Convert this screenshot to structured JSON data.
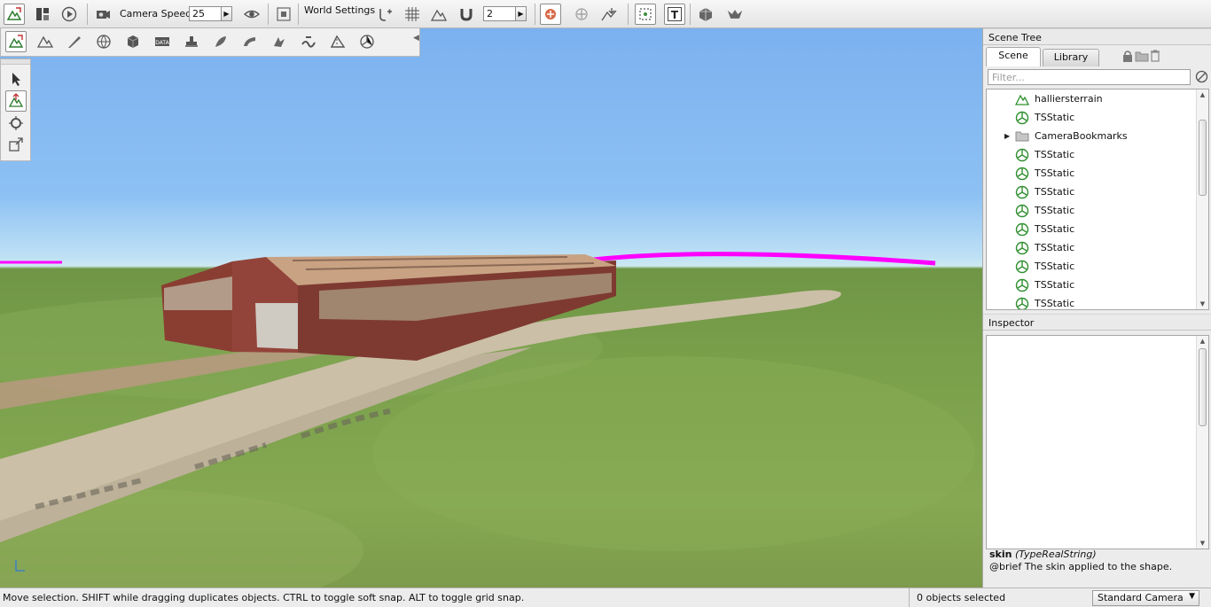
{
  "toolbar": {
    "camera_speed_label": "Camera Speed",
    "camera_speed_value": "25",
    "world_settings_label": "World Settings",
    "snap_value": "2",
    "text_tool_glyph": "T"
  },
  "secondary_toolbar": {
    "data_tool_glyph": "DATA"
  },
  "scene_tree": {
    "title": "Scene Tree",
    "tabs": [
      "Scene",
      "Library"
    ],
    "filter_placeholder": "Filter...",
    "items": [
      {
        "label": "halliersterrain",
        "icon": "terrain-icon"
      },
      {
        "label": "TSStatic",
        "icon": "tsstatic-icon"
      },
      {
        "label": "CameraBookmarks",
        "icon": "folder-icon",
        "expander": "▶"
      },
      {
        "label": "TSStatic",
        "icon": "tsstatic-icon"
      },
      {
        "label": "TSStatic",
        "icon": "tsstatic-icon"
      },
      {
        "label": "TSStatic",
        "icon": "tsstatic-icon"
      },
      {
        "label": "TSStatic",
        "icon": "tsstatic-icon"
      },
      {
        "label": "TSStatic",
        "icon": "tsstatic-icon"
      },
      {
        "label": "TSStatic",
        "icon": "tsstatic-icon"
      },
      {
        "label": "TSStatic",
        "icon": "tsstatic-icon"
      },
      {
        "label": "TSStatic",
        "icon": "tsstatic-icon"
      },
      {
        "label": "TSStatic",
        "icon": "tsstatic-icon"
      }
    ]
  },
  "inspector": {
    "title": "Inspector",
    "field_name": "skin",
    "field_type": "(TypeRealString)",
    "field_doc": "@brief The skin applied to the shape."
  },
  "statusbar": {
    "message": "Move selection.  SHIFT while dragging duplicates objects.  CTRL to toggle soft snap.  ALT to toggle grid snap.",
    "selection": "0 objects selected",
    "camera_mode": "Standard Camera"
  },
  "colors": {
    "sky": "#8dc1f4",
    "grass": "#7aa04b",
    "terrain_edge_magenta": "#ff00ff",
    "barn_wall": "#8a3e32",
    "tsstatic_icon_green": "#2f8f2f"
  }
}
